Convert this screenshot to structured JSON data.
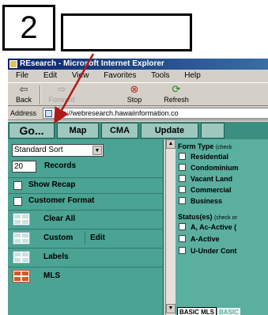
{
  "callout": {
    "number": "2",
    "blank_box": ""
  },
  "window": {
    "title": "REsearch - Microsoft Internet Explorer",
    "menu": [
      "File",
      "Edit",
      "View",
      "Favorites",
      "Tools",
      "Help"
    ],
    "toolbar": {
      "back": "Back",
      "forward": "Forward",
      "stop": "Stop",
      "refresh": "Refresh"
    },
    "address_label": "Address",
    "address_value": "http://webresearch.hawaiinformation.co"
  },
  "nav": {
    "go": "Go...",
    "map": "Map",
    "cma": "CMA",
    "update": "Update",
    "tail": ""
  },
  "left": {
    "sort_value": "Standard Sort",
    "records_value": "20",
    "records_label": "Records",
    "checks": [
      "Show Recap",
      "Customer Format"
    ],
    "grid_items": {
      "clear_all": "Clear All",
      "custom": "Custom",
      "edit": "Edit",
      "labels": "Labels",
      "mls": "MLS"
    }
  },
  "right": {
    "form_type_head": "Form Type",
    "form_type_hint": "(check",
    "form_types": [
      "Residential",
      "Condominium",
      "Vacant Land",
      "Commercial",
      "Business"
    ],
    "status_head": "Status(es)",
    "status_hint": "(check or",
    "statuses": [
      "A, Ac-Active (",
      "A-Active",
      "U-Under Cont"
    ],
    "tabs": [
      "BASIC MLS",
      "BASIC"
    ]
  },
  "colors": {
    "panel_teal": "#4ba393",
    "nav_teal": "#3b8f80",
    "button_teal": "#9ec8be",
    "arrow_red": "#b01818",
    "title_blue": "#0a246a"
  }
}
